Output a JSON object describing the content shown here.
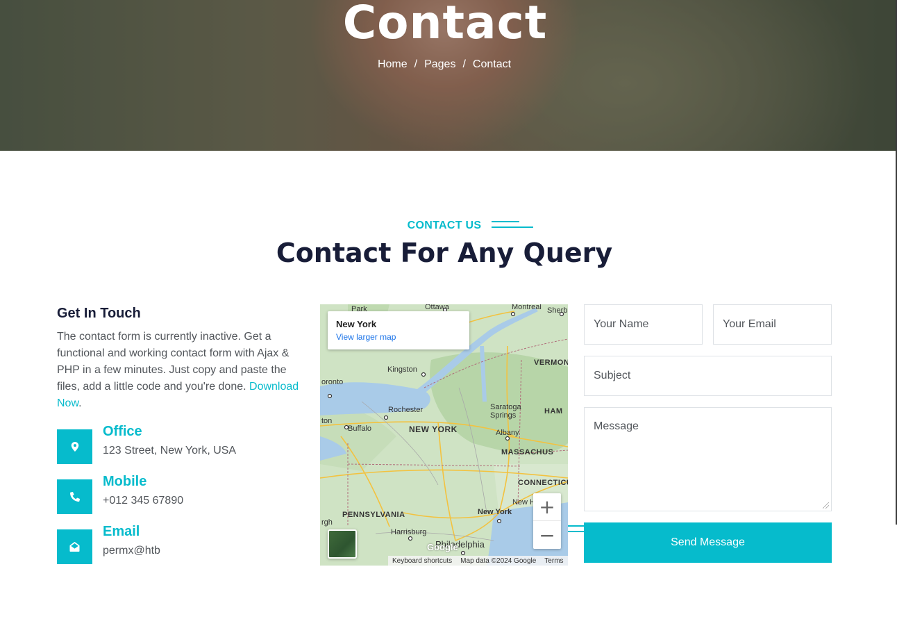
{
  "hero": {
    "title": "Contact",
    "breadcrumb": [
      "Home",
      "Pages",
      "Contact"
    ],
    "separator": "/"
  },
  "section": {
    "eyebrow": "CONTACT US",
    "title": "Contact For Any Query"
  },
  "get_in_touch": {
    "title": "Get In Touch",
    "text": "The contact form is currently inactive. Get a functional and working contact form with Ajax & PHP in a few minutes. Just copy and paste the files, add a little code and you're done. ",
    "link": "Download Now",
    "trailing": "."
  },
  "info": [
    {
      "title": "Office",
      "value": "123 Street, New York, USA",
      "icon": "map-marker-icon"
    },
    {
      "title": "Mobile",
      "value": "+012 345 67890",
      "icon": "phone-icon"
    },
    {
      "title": "Email",
      "value": "permx@htb",
      "icon": "envelope-open-icon"
    }
  ],
  "map": {
    "place_title": "New York",
    "larger_map_link": "View larger map",
    "zoom_in": "+",
    "zoom_out": "−",
    "google": "Google",
    "footer": [
      "Keyboard shortcuts",
      "Map data ©2024 Google",
      "Terms"
    ],
    "labels": {
      "ottawa": "Ottawa",
      "montreal": "Montreal",
      "sherbrooke": "Sherbr",
      "park": "Park",
      "kingston": "Kingston",
      "vermont": "VERMONT",
      "toronto": "oronto",
      "rochester": "Rochester",
      "saratoga": "Saratoga Springs",
      "hamp": "HAM",
      "hamilton": "ton",
      "buffalo": "Buffalo",
      "new_york_state": "NEW YORK",
      "albany": "Albany",
      "massachusetts": "MASSACHUS",
      "connecticut": "CONNECTICU",
      "pennsylvania": "PENNSYLVANIA",
      "new_york_city": "New York",
      "newha": "New Ha",
      "harrisburg": "Harrisburg",
      "philadelphia": "Philadelphia",
      "pgh": "rgh"
    }
  },
  "form": {
    "name_placeholder": "Your Name",
    "email_placeholder": "Your Email",
    "subject_placeholder": "Subject",
    "message_placeholder": "Message",
    "submit_label": "Send Message"
  },
  "colors": {
    "accent": "#06bbcc",
    "heading": "#181d38",
    "text": "#52565b"
  }
}
